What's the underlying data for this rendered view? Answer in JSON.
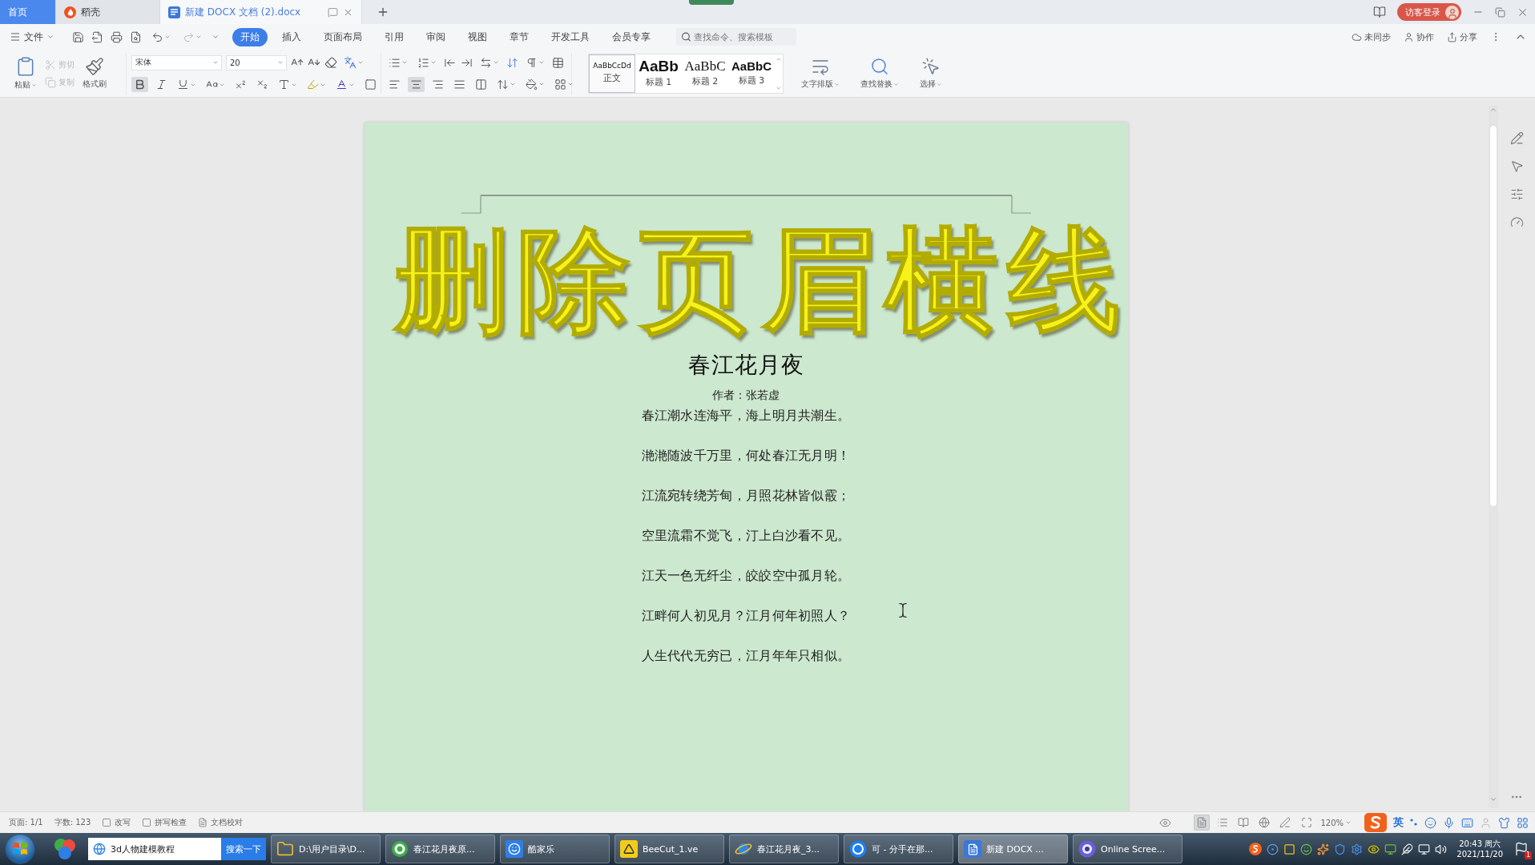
{
  "tabs": [
    {
      "label": "首页",
      "kind": "home",
      "selected": false
    },
    {
      "label": "稻壳",
      "kind": "docer",
      "selected": false
    },
    {
      "label": "新建 DOCX 文档 (2).docx",
      "kind": "document",
      "selected": true
    }
  ],
  "account": {
    "label": "访客登录"
  },
  "menu": {
    "file": "文件",
    "items": [
      {
        "label": "开始",
        "selected": true
      },
      {
        "label": "插入",
        "selected": false
      },
      {
        "label": "页面布局",
        "selected": false
      },
      {
        "label": "引用",
        "selected": false
      },
      {
        "label": "审阅",
        "selected": false
      },
      {
        "label": "视图",
        "selected": false
      },
      {
        "label": "章节",
        "selected": false
      },
      {
        "label": "开发工具",
        "selected": false
      },
      {
        "label": "会员专享",
        "selected": false
      }
    ],
    "search": {
      "placeholder": "查找命令、搜索模板"
    },
    "actions": [
      {
        "label": "未同步",
        "kind": "sync"
      },
      {
        "label": "协作",
        "kind": "collaborate"
      },
      {
        "label": "分享",
        "kind": "share"
      }
    ]
  },
  "ribbon": {
    "paste": "粘贴",
    "clipboard": [
      {
        "label": "剪切",
        "kind": "cut",
        "disabled": true
      },
      {
        "label": "复制",
        "kind": "copy",
        "disabled": true
      }
    ],
    "format_painter": "格式刷",
    "font": {
      "name": "宋体",
      "size": "20"
    },
    "formats": [
      {
        "kind": "bold",
        "selected": true
      },
      {
        "kind": "italic",
        "selected": false
      },
      {
        "kind": "underline",
        "selected": false
      },
      {
        "kind": "font_effects",
        "selected": false
      },
      {
        "kind": "superscript",
        "selected": false
      },
      {
        "kind": "subscript",
        "selected": false
      },
      {
        "kind": "text_effect",
        "selected": false
      },
      {
        "kind": "highlight",
        "selected": false
      },
      {
        "kind": "font_color",
        "selected": false
      },
      {
        "kind": "char_border",
        "selected": false
      }
    ],
    "alignments": [
      {
        "kind": "left",
        "selected": false
      },
      {
        "kind": "center",
        "selected": true
      },
      {
        "kind": "right",
        "selected": false
      },
      {
        "kind": "justify",
        "selected": false
      },
      {
        "kind": "distributed",
        "selected": false
      }
    ],
    "styles": [
      {
        "preview": "AaBbCcDd",
        "label": "正文",
        "kind": "body",
        "selected": true
      },
      {
        "preview": "AaBb",
        "label": "标题 1",
        "kind": "heading1",
        "selected": false
      },
      {
        "preview": "AaBbC",
        "label": "标题 2",
        "kind": "heading2",
        "selected": false
      },
      {
        "preview": "AaBbC",
        "label": "标题 3",
        "kind": "heading3",
        "selected": false
      }
    ],
    "tools": [
      {
        "label": "文字排版",
        "kind": "layout"
      },
      {
        "label": "查找替换",
        "kind": "find"
      },
      {
        "label": "选择",
        "kind": "select"
      }
    ]
  },
  "document": {
    "header_line": true,
    "title": "春江花月夜",
    "author": "作者：张若虚",
    "lines": [
      "春江潮水连海平，海上明月共潮生。",
      "滟滟随波千万里，何处春江无月明！",
      "江流宛转绕芳甸，月照花林皆似霰；",
      "空里流霜不觉飞，汀上白沙看不见。",
      "江天一色无纤尘，皎皎空中孤月轮。",
      "江畔何人初见月？江月何年初照人？",
      "人生代代无穷已，江月年年只相似。"
    ]
  },
  "caption": "删除页眉横线",
  "status_bar": {
    "page": "页面: 1/1",
    "words": "字数: 123",
    "toggles": [
      {
        "label": "改写",
        "kind": "overwrite"
      },
      {
        "label": "拼写检查",
        "kind": "spellcheck"
      },
      {
        "label": "文档校对",
        "kind": "proofread"
      }
    ],
    "views": [
      {
        "kind": "page",
        "selected": true
      },
      {
        "kind": "outline",
        "selected": false
      },
      {
        "kind": "reading",
        "selected": false
      },
      {
        "kind": "web",
        "selected": false
      },
      {
        "kind": "write",
        "selected": false
      }
    ],
    "zoom": "120%",
    "ime_mode": "英"
  },
  "taskbar": {
    "search": {
      "value": "3d人物建模教程",
      "button": "搜索一下"
    },
    "tasks": [
      {
        "label": "D:\\用户目录\\D...",
        "kind": "folder",
        "selected": false
      },
      {
        "label": "春江花月夜原...",
        "kind": "browser",
        "selected": false
      },
      {
        "label": "酷家乐",
        "kind": "smile",
        "selected": false
      },
      {
        "label": "BeeCut_1.ve",
        "kind": "warning",
        "selected": false
      },
      {
        "label": "春江花月夜_3...",
        "kind": "ie",
        "selected": false
      },
      {
        "label": "可 - 分手在那...",
        "kind": "music",
        "selected": false
      },
      {
        "label": "新建 DOCX ...",
        "kind": "writer",
        "selected": true
      },
      {
        "label": "Online Scree...",
        "kind": "recorder",
        "selected": false
      }
    ],
    "clock": {
      "time": "20:43 周六",
      "date": "2021/11/20"
    },
    "notification_count": "1"
  }
}
